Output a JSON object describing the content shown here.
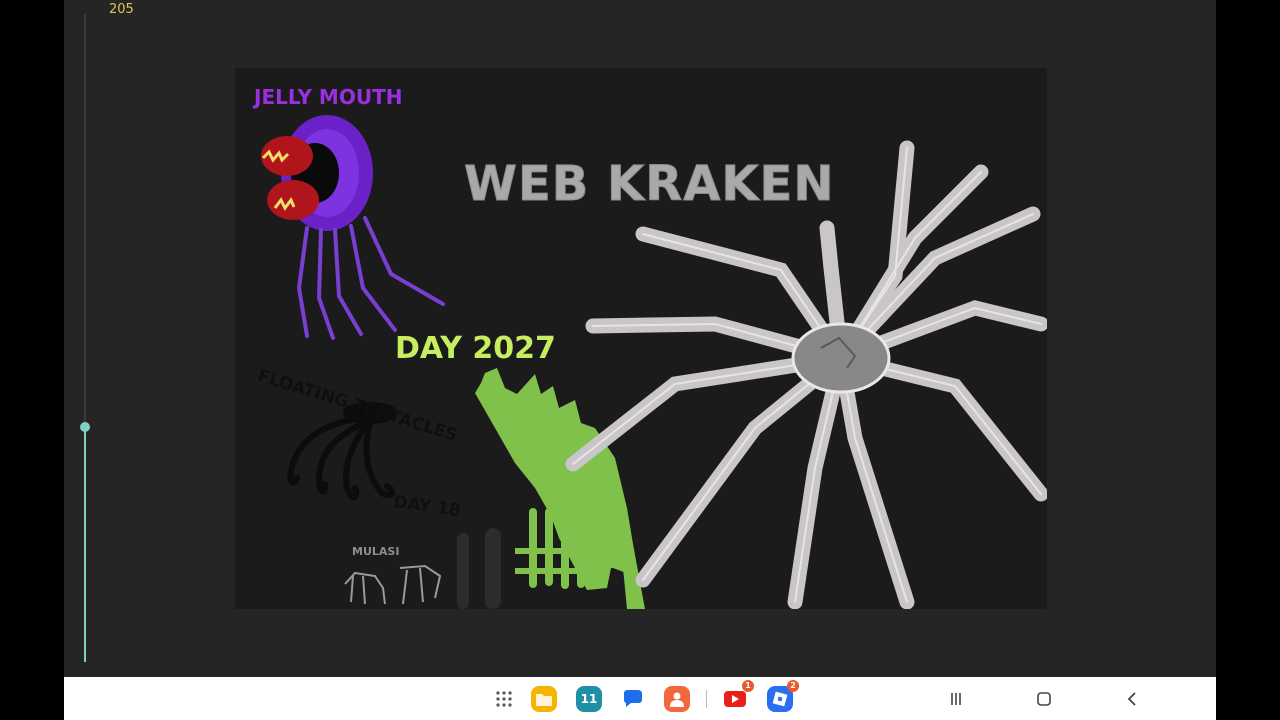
{
  "player": {
    "slider_value": "205",
    "slider_fraction": 0.36
  },
  "artwork": {
    "labels": {
      "jelly_mouth": "JELLY MOUTH",
      "web_kraken": "WEB KRAKEN",
      "day_2027": "DAY 2027",
      "floating_tentacles": "FLOATING TENTACLES",
      "day_18": "DAY 18",
      "mulasi": "MULASI"
    },
    "colors": {
      "jelly_purple": "#9a2fe0",
      "jelly_red": "#b0151c",
      "kraken_grey": "#a9a9a9",
      "day2027_green": "#c6ee5e",
      "creature_green": "#7fc14a"
    }
  },
  "taskbar": {
    "apps": [
      {
        "name": "apps-grid-icon"
      },
      {
        "name": "files-icon",
        "color": "#f5b400"
      },
      {
        "name": "calendar-icon",
        "color": "#1f8fa6",
        "text": "11"
      },
      {
        "name": "messages-icon",
        "color": "#1d6ee8"
      },
      {
        "name": "contacts-icon",
        "color": "#f2683c"
      },
      {
        "name": "youtube-icon",
        "color": "#e62117",
        "badge": "1"
      },
      {
        "name": "roblox-icon",
        "color": "#2a6ef2",
        "badge": "2"
      }
    ],
    "nav": [
      "recents-icon",
      "home-icon",
      "back-icon"
    ]
  }
}
